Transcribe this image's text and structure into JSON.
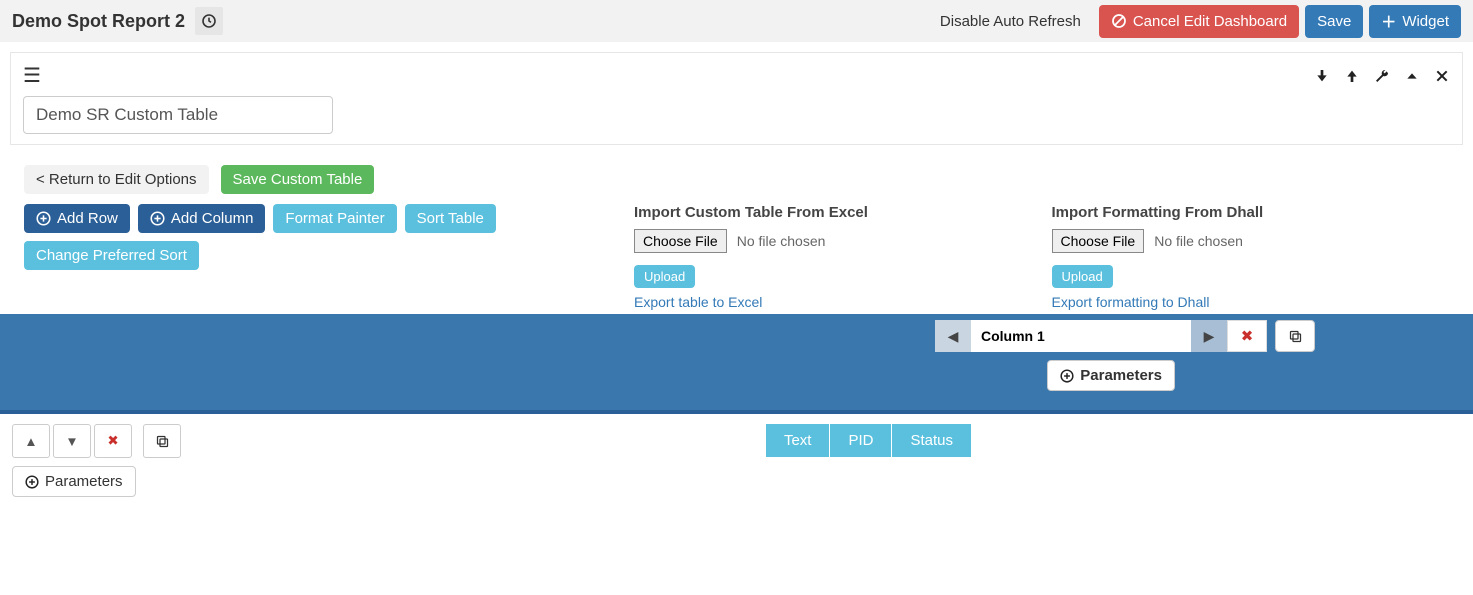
{
  "header": {
    "title": "Demo Spot Report 2",
    "disable_auto_refresh": "Disable Auto Refresh",
    "cancel_edit": "Cancel Edit Dashboard",
    "save": "Save",
    "widget": "Widget"
  },
  "widget": {
    "name_value": "Demo SR Custom Table"
  },
  "actions": {
    "return": "< Return to Edit Options",
    "save_table": "Save Custom Table",
    "add_row": "Add Row",
    "add_column": "Add Column",
    "format_painter": "Format Painter",
    "sort_table": "Sort Table",
    "change_sort": "Change Preferred Sort"
  },
  "import_excel": {
    "label": "Import Custom Table From Excel",
    "choose": "Choose File",
    "no_file": "No file chosen",
    "upload": "Upload",
    "export": "Export table to Excel"
  },
  "import_dhall": {
    "label": "Import Formatting From Dhall",
    "choose": "Choose File",
    "no_file": "No file chosen",
    "upload": "Upload",
    "export": "Export formatting to Dhall"
  },
  "column": {
    "name": "Column 1",
    "parameters": "Parameters"
  },
  "row": {
    "parameters": "Parameters"
  },
  "tabs": {
    "text": "Text",
    "pid": "PID",
    "status": "Status"
  }
}
